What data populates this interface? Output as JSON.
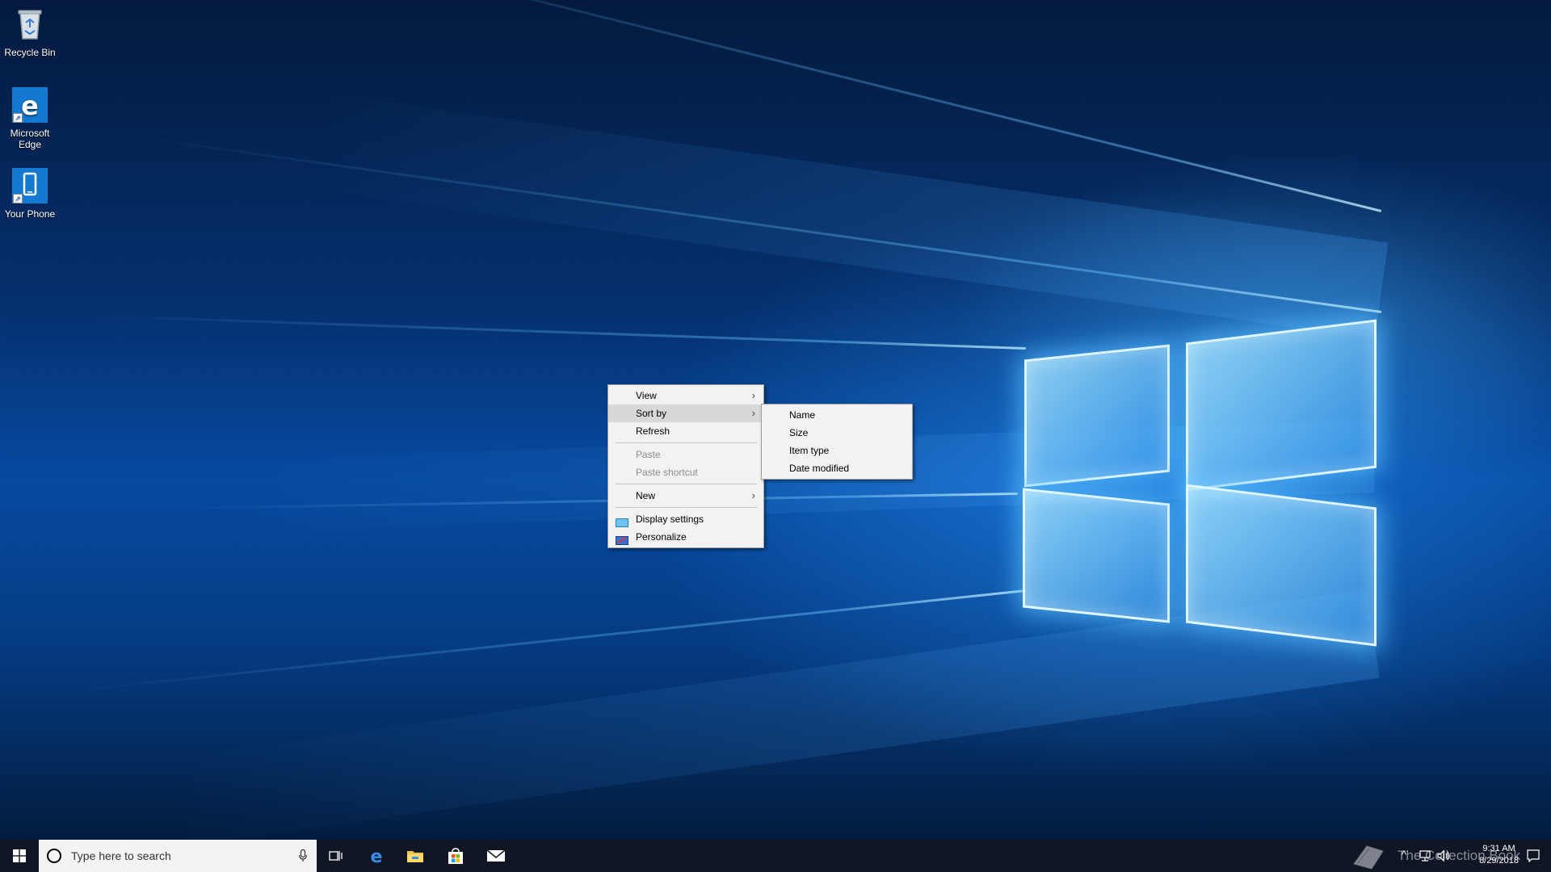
{
  "desktop": {
    "icons": [
      {
        "label": "Recycle Bin"
      },
      {
        "label": "Microsoft Edge"
      },
      {
        "label": "Your Phone"
      }
    ]
  },
  "context_menu": {
    "items": [
      {
        "label": "View",
        "has_submenu": true
      },
      {
        "label": "Sort by",
        "has_submenu": true,
        "highlighted": true
      },
      {
        "label": "Refresh"
      },
      {
        "label": "Paste",
        "disabled": true
      },
      {
        "label": "Paste shortcut",
        "disabled": true
      },
      {
        "label": "New",
        "has_submenu": true
      },
      {
        "label": "Display settings",
        "icon": "display-settings-icon"
      },
      {
        "label": "Personalize",
        "icon": "personalize-icon"
      }
    ],
    "submenu_arrow": "›"
  },
  "sort_submenu": {
    "items": [
      {
        "label": "Name"
      },
      {
        "label": "Size"
      },
      {
        "label": "Item type"
      },
      {
        "label": "Date modified"
      }
    ]
  },
  "taskbar": {
    "search_placeholder": "Type here to search",
    "pinned": [
      "task-view-icon",
      "edge-icon",
      "file-explorer-icon",
      "store-icon",
      "mail-icon"
    ],
    "clock": {
      "time": "9:31 AM",
      "date": "8/29/2018"
    },
    "watermark": "The Collection Book"
  },
  "colors": {
    "accent": "#0078d7",
    "taskbar": "#101623",
    "menu_bg": "#f2f2f2",
    "menu_hover": "#d8d8d8"
  }
}
